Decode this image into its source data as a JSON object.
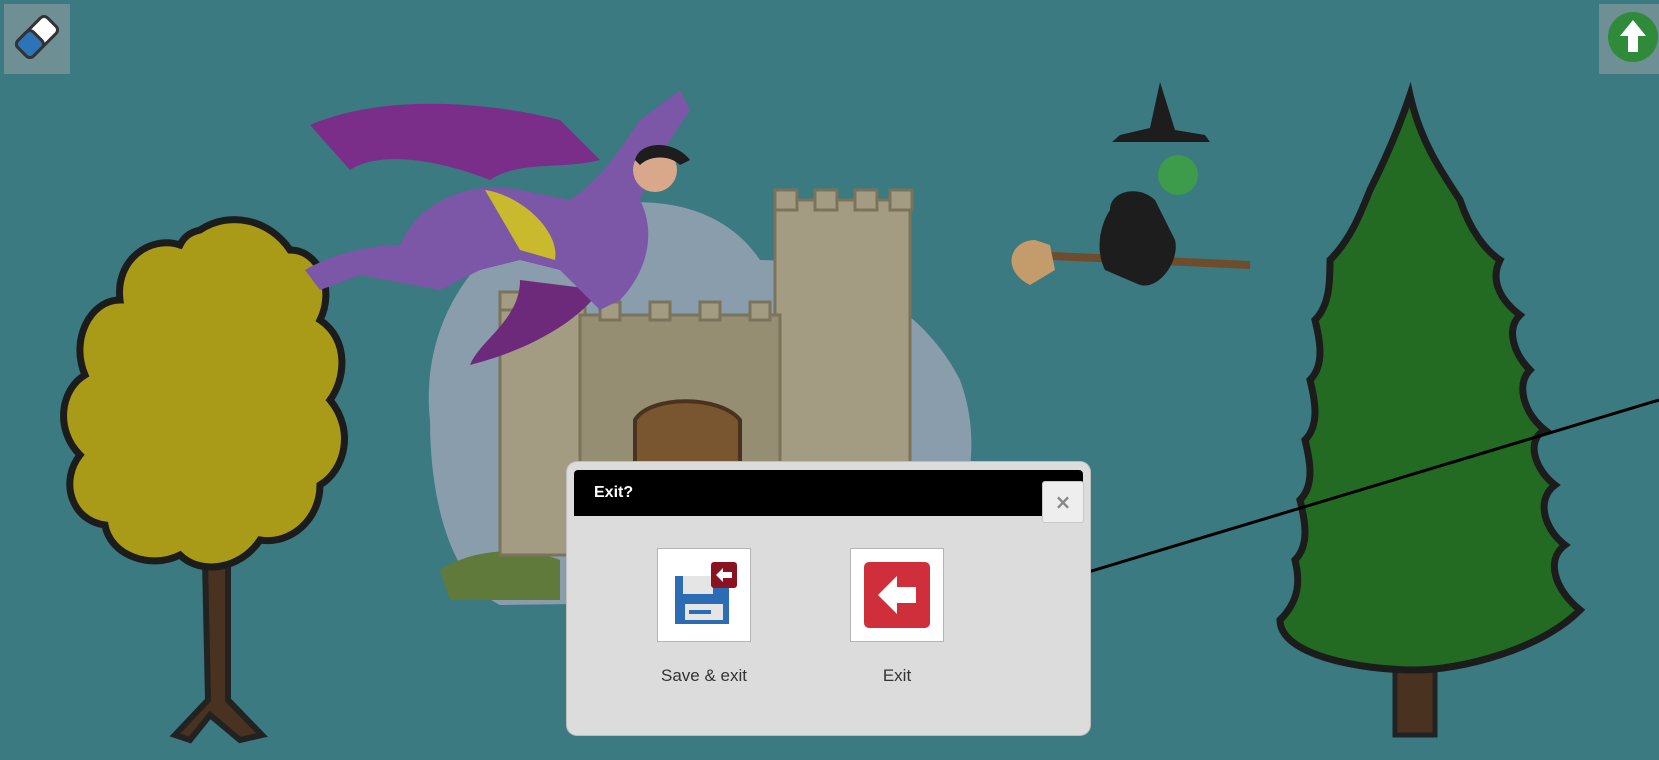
{
  "toolbar": {
    "eraser_icon": "eraser-icon",
    "upload_icon": "arrow-up-circle-icon"
  },
  "scene": {
    "background_color": "#3a7a80",
    "items": [
      "yellow-tree",
      "superhero",
      "castle",
      "witch-on-broom",
      "pine-tree"
    ]
  },
  "dialog": {
    "title": "Exit?",
    "close_symbol": "×",
    "actions": [
      {
        "label": "Save & exit",
        "icon": "save-exit-icon",
        "accent": "#8b1220"
      },
      {
        "label": "Exit",
        "icon": "exit-arrow-icon",
        "accent": "#cf2e3b"
      }
    ]
  }
}
